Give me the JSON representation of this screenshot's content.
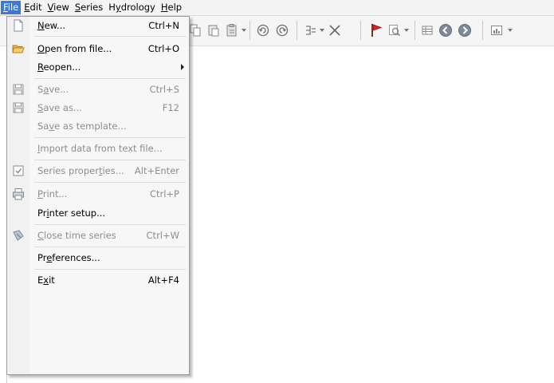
{
  "menubar": {
    "items": [
      {
        "label": "File",
        "hotkey_index": 0
      },
      {
        "label": "Edit",
        "hotkey_index": 0
      },
      {
        "label": "View",
        "hotkey_index": 0
      },
      {
        "label": "Series",
        "hotkey_index": 0
      },
      {
        "label": "Hydrology",
        "hotkey_index": 1
      },
      {
        "label": "Help",
        "hotkey_index": 0
      }
    ],
    "active_item": "File"
  },
  "toolbar": {
    "icons": [
      "copy-icon",
      "paste-icon",
      "paste-special-icon",
      "undo-icon",
      "redo-icon",
      "insert-value-icon",
      "delete-icon",
      "flag-icon",
      "zoom-icon",
      "table-icon",
      "back-icon",
      "forward-icon",
      "chart-icon"
    ]
  },
  "file_menu": {
    "items": [
      {
        "id": "new",
        "label_pre": "",
        "label_u": "N",
        "label_post": "ew...",
        "shortcut": "Ctrl+N",
        "disabled": false,
        "icon": "new-file-icon"
      },
      {
        "id": "open",
        "label_pre": "",
        "label_u": "O",
        "label_post": "pen from file...",
        "shortcut": "Ctrl+O",
        "disabled": false,
        "icon": "open-folder-icon"
      },
      {
        "id": "reopen",
        "label_pre": "",
        "label_u": "R",
        "label_post": "eopen...",
        "shortcut": "",
        "disabled": false,
        "icon": "",
        "submenu": true
      },
      {
        "id": "save",
        "label_pre": "S",
        "label_u": "a",
        "label_post": "ve...",
        "shortcut": "Ctrl+S",
        "disabled": true,
        "icon": "save-icon"
      },
      {
        "id": "saveas",
        "label_pre": "",
        "label_u": "S",
        "label_post": "ave as...",
        "shortcut": "F12",
        "disabled": true,
        "icon": "save-as-icon"
      },
      {
        "id": "savetemplate",
        "label_pre": "Sa",
        "label_u": "v",
        "label_post": "e as template...",
        "shortcut": "",
        "disabled": true,
        "icon": ""
      },
      {
        "id": "import",
        "label_pre": "",
        "label_u": "I",
        "label_post": "mport data from text file...",
        "shortcut": "",
        "disabled": true,
        "icon": ""
      },
      {
        "id": "properties",
        "label_pre": "Series proper",
        "label_u": "t",
        "label_post": "ies...",
        "shortcut": "Alt+Enter",
        "disabled": true,
        "icon": "properties-icon"
      },
      {
        "id": "print",
        "label_pre": "",
        "label_u": "P",
        "label_post": "rint...",
        "shortcut": "Ctrl+P",
        "disabled": true,
        "icon": "printer-icon"
      },
      {
        "id": "printersetup",
        "label_pre": "Pr",
        "label_u": "i",
        "label_post": "nter setup...",
        "shortcut": "",
        "disabled": false,
        "icon": ""
      },
      {
        "id": "close",
        "label_pre": "",
        "label_u": "C",
        "label_post": "lose time series",
        "shortcut": "Ctrl+W",
        "disabled": true,
        "icon": "close-series-icon"
      },
      {
        "id": "preferences",
        "label_pre": "Pr",
        "label_u": "e",
        "label_post": "ferences...",
        "shortcut": "",
        "disabled": false,
        "icon": ""
      },
      {
        "id": "exit",
        "label_pre": "E",
        "label_u": "x",
        "label_post": "it",
        "shortcut": "Alt+F4",
        "disabled": false,
        "icon": ""
      }
    ]
  },
  "colors": {
    "menu_highlight": "#3b78d8",
    "disabled_text": "#8d8d8d",
    "flag_red": "#d9232d",
    "nav_gray": "#7d8a99"
  }
}
